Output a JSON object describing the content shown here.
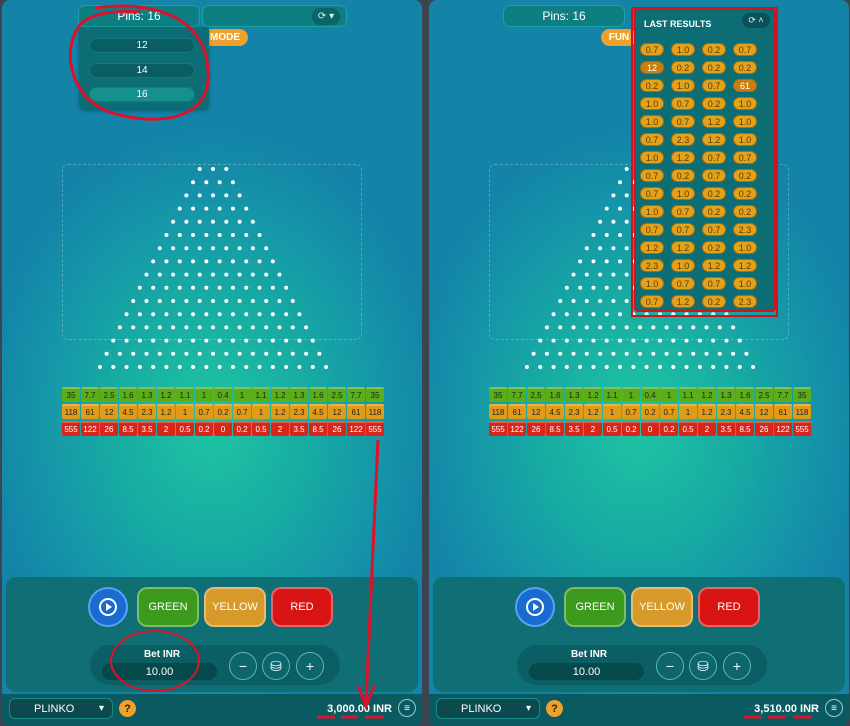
{
  "left": {
    "pins_label": "Pins: 16",
    "mode_label": "MODE",
    "pins_options": [
      "12",
      "14",
      "16"
    ],
    "balance": "3,000.00 INR"
  },
  "right": {
    "pins_label": "Pins: 16",
    "mode_label": "FUN",
    "last_results_title": "LAST RESULTS",
    "last_results": [
      [
        "0.7",
        "1.0",
        "0.2",
        "0.7"
      ],
      [
        "12",
        "0.2",
        "0.2",
        "0.2"
      ],
      [
        "0.2",
        "1.0",
        "0.7",
        "61"
      ],
      [
        "1.0",
        "0.7",
        "0.2",
        "1.0"
      ],
      [
        "1.0",
        "0.7",
        "1.2",
        "1.0"
      ],
      [
        "0.7",
        "2.3",
        "1.2",
        "1.0"
      ],
      [
        "1.0",
        "1.2",
        "0.7",
        "0.7"
      ],
      [
        "0.7",
        "0.2",
        "0.7",
        "0.2"
      ],
      [
        "0.7",
        "1.0",
        "0.2",
        "0.2"
      ],
      [
        "1.0",
        "0.7",
        "0.2",
        "0.2"
      ],
      [
        "0.7",
        "0.7",
        "0.7",
        "2.3"
      ],
      [
        "1.2",
        "1.2",
        "0.2",
        "1.0"
      ],
      [
        "2.3",
        "1.0",
        "1.2",
        "1.2"
      ],
      [
        "1.0",
        "0.7",
        "0.7",
        "1.0"
      ],
      [
        "0.7",
        "1.2",
        "0.2",
        "2.3"
      ]
    ],
    "balance": "3,510.00 INR"
  },
  "multipliers": {
    "green": [
      "35",
      "7.7",
      "2.5",
      "1.6",
      "1.3",
      "1.2",
      "1.1",
      "1",
      "0.4",
      "1",
      "1.1",
      "1.2",
      "1.3",
      "1.6",
      "2.5",
      "7.7",
      "35"
    ],
    "yellow": [
      "118",
      "61",
      "12",
      "4.5",
      "2.3",
      "1.2",
      "1",
      "0.7",
      "0.2",
      "0.7",
      "1",
      "1.2",
      "2.3",
      "4.5",
      "12",
      "61",
      "118"
    ],
    "red": [
      "555",
      "122",
      "26",
      "8.5",
      "3.5",
      "2",
      "0.5",
      "0.2",
      "0",
      "0.2",
      "0.5",
      "2",
      "3.5",
      "8.5",
      "26",
      "122",
      "555"
    ]
  },
  "buttons": {
    "green": "GREEN",
    "yellow": "YELLOW",
    "red": "RED"
  },
  "bet": {
    "label": "Bet INR",
    "value": "10.00",
    "minus": "−",
    "plus": "+"
  },
  "game": {
    "name": "PLINKO",
    "help": "?",
    "menu": "≡"
  },
  "icons": {
    "auto": "autoplay-icon",
    "history": "history-icon",
    "coins": "coins-icon",
    "chevron": "chevron-down-icon"
  }
}
